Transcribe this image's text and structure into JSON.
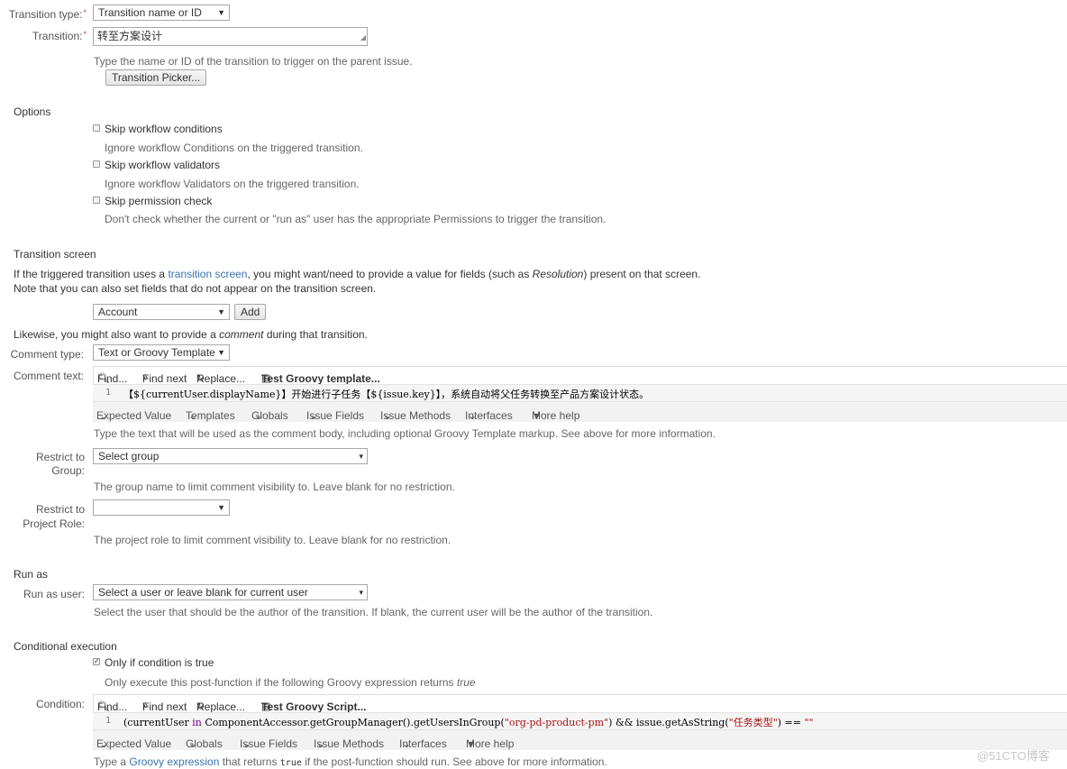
{
  "transition_type": {
    "label": "Transition type:",
    "value": "Transition name or ID"
  },
  "transition": {
    "label": "Transition:",
    "value": "转至方案设计",
    "description": "Type the name or ID of the transition to trigger on the parent issue.",
    "picker_button": "Transition Picker..."
  },
  "options": {
    "heading": "Options",
    "items": [
      {
        "label": "Skip workflow conditions",
        "description": "Ignore workflow Conditions on the triggered transition.",
        "checked": false
      },
      {
        "label": "Skip workflow validators",
        "description": "Ignore workflow Validators on the triggered transition.",
        "checked": false
      },
      {
        "label": "Skip permission check",
        "description": "Don't check whether the current or \"run as\" user has the appropriate Permissions to trigger the transition.",
        "checked": false
      }
    ]
  },
  "transition_screen": {
    "heading": "Transition screen",
    "line1_pre": "If the triggered transition uses a ",
    "line1_link": "transition screen",
    "line1_mid": ", you might want/need to provide a value for fields (such as ",
    "line1_em": "Resolution",
    "line1_post": ") present on that screen.",
    "line2": "Note that you can also set fields that do not appear on the transition screen.",
    "field_select": "Account",
    "add_button": "Add",
    "comment_pre": "Likewise, you might also want to provide a ",
    "comment_em": "comment",
    "comment_post": " during that transition."
  },
  "comment_type": {
    "label": "Comment type:",
    "value": "Text or Groovy Template"
  },
  "comment_text": {
    "label": "Comment text:",
    "toolbar": {
      "find": "Find...",
      "find_next": "Find next",
      "replace": "Replace...",
      "test": "Test Groovy template..."
    },
    "line_number": "1",
    "code": "【${currentUser.displayName}】开始进行子任务【${issue.key}】，系统自动将父任务转换至产品方案设计状态。",
    "help": [
      "Expected Value",
      "Templates",
      "Globals",
      "Issue Fields",
      "Issue Methods",
      "Interfaces",
      "More help"
    ],
    "description": "Type the text that will be used as the comment body, including optional Groovy Template markup. See above for more information."
  },
  "restrict_group": {
    "label_1": "Restrict to",
    "label_2": "Group:",
    "placeholder": "Select group",
    "description": "The group name to limit comment visibility to. Leave blank for no restriction."
  },
  "restrict_role": {
    "label_1": "Restrict to",
    "label_2": "Project Role:",
    "value": "",
    "description": "The project role to limit comment visibility to. Leave blank for no restriction."
  },
  "run_as": {
    "heading": "Run as",
    "label": "Run as user:",
    "placeholder": "Select a user or leave blank for current user",
    "description": "Select the user that should be the author of the transition. If blank, the current user will be the author of the transition."
  },
  "conditional": {
    "heading": "Conditional execution",
    "checkbox_label": "Only if condition is true",
    "checked": true,
    "desc_pre": "Only execute this post-function if the following Groovy expression returns ",
    "desc_em": "true"
  },
  "condition": {
    "label": "Condition:",
    "toolbar": {
      "find": "Find...",
      "find_next": "Find next",
      "replace": "Replace...",
      "test": "Test Groovy Script..."
    },
    "line_number": "1",
    "code_parts": {
      "p1": "(currentUser ",
      "kw": "in",
      "p2": " ComponentAccessor.getGroupManager().getUsersInGroup(",
      "s1": "\"org-pd-product-pm\"",
      "p3": ") && issue.getAsString(",
      "s2": "\"任务类型\"",
      "p4": ") == ",
      "s3": "\"\""
    },
    "help": [
      "Expected Value",
      "Globals",
      "Issue Fields",
      "Issue Methods",
      "Interfaces",
      "More help"
    ],
    "desc_pre": "Type a ",
    "desc_link": "Groovy expression",
    "desc_mid": " that returns ",
    "desc_code": "true",
    "desc_post": " if the post-function should run. See above for more information."
  },
  "watermark": "@51CTO博客"
}
